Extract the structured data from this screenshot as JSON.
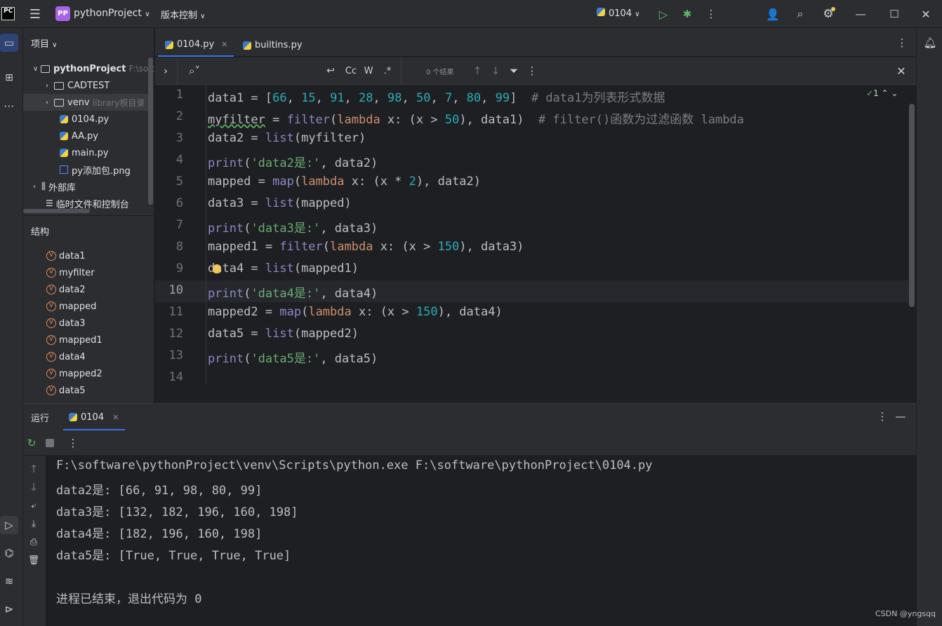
{
  "titlebar": {
    "logo": "PC",
    "project_badge": "PP",
    "project_name": "pythonProject",
    "vcs_label": "版本控制",
    "run_config": "0104"
  },
  "project_panel": {
    "header": "项目",
    "items": [
      {
        "label": "pythonProject",
        "hint": "F:\\soft",
        "type": "folder",
        "expanded": true
      },
      {
        "label": "CADTEST",
        "type": "folder"
      },
      {
        "label": "venv",
        "hint": "library根目录",
        "type": "folder"
      },
      {
        "label": "0104.py",
        "type": "py"
      },
      {
        "label": "AA.py",
        "type": "py"
      },
      {
        "label": "main.py",
        "type": "py"
      },
      {
        "label": "py添加包.png",
        "type": "img"
      },
      {
        "label": "外部库",
        "type": "lib"
      },
      {
        "label": "临时文件和控制台",
        "type": "scratch"
      }
    ]
  },
  "structure_panel": {
    "header": "结构",
    "items": [
      "data1",
      "myfilter",
      "data2",
      "mapped",
      "data3",
      "mapped1",
      "data4",
      "mapped2",
      "data5"
    ],
    "badge": "V"
  },
  "editor": {
    "tabs": [
      {
        "label": "0104.py",
        "active": true
      },
      {
        "label": "builtins.py",
        "active": false
      }
    ],
    "find": {
      "results": "0 个结果",
      "cc": "Cc",
      "w": "W",
      "regex": ".*"
    },
    "inspection_count": "1",
    "line_numbers": [
      "1",
      "2",
      "3",
      "4",
      "5",
      "6",
      "7",
      "8",
      "9",
      "10",
      "11",
      "12",
      "13",
      "14"
    ],
    "current_line": 10
  },
  "run_panel": {
    "title": "运行",
    "tab": "0104",
    "output": [
      "F:\\software\\pythonProject\\venv\\Scripts\\python.exe F:\\software\\pythonProject\\0104.py",
      "data2是: [66, 91, 98, 80, 99]",
      "data3是: [132, 182, 196, 160, 198]",
      "data4是: [182, 196, 160, 198]",
      "data5是: [True, True, True, True]",
      "",
      "进程已结束，退出代码为 0"
    ]
  },
  "watermark": "CSDN @yngsqq",
  "colors": {
    "bg": "#1e1f22",
    "panel": "#2b2d30",
    "keyword": "#cf8e6d",
    "function": "#56a8f5",
    "number": "#2aacb8",
    "string": "#6aab73",
    "comment": "#7a7e85",
    "accent": "#3574f0"
  }
}
